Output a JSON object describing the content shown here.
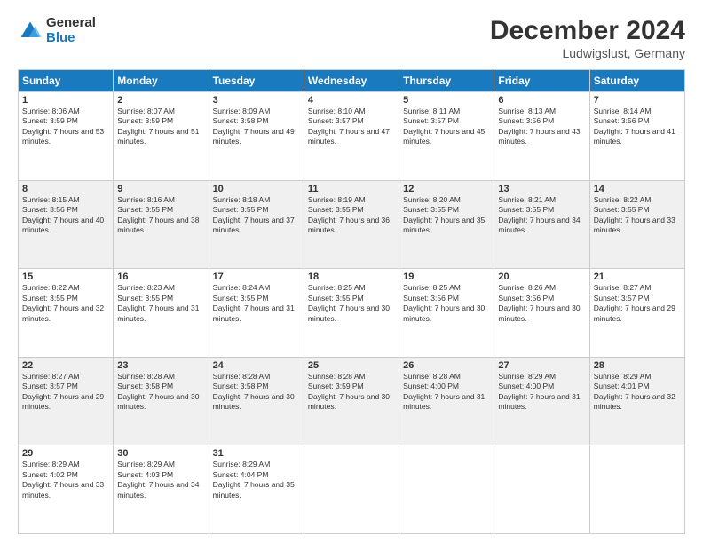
{
  "logo": {
    "general": "General",
    "blue": "Blue"
  },
  "header": {
    "month": "December 2024",
    "location": "Ludwigslust, Germany"
  },
  "weekdays": [
    "Sunday",
    "Monday",
    "Tuesday",
    "Wednesday",
    "Thursday",
    "Friday",
    "Saturday"
  ],
  "weeks": [
    [
      {
        "day": "1",
        "sunrise": "8:06 AM",
        "sunset": "3:59 PM",
        "daylight": "7 hours and 53 minutes."
      },
      {
        "day": "2",
        "sunrise": "8:07 AM",
        "sunset": "3:59 PM",
        "daylight": "7 hours and 51 minutes."
      },
      {
        "day": "3",
        "sunrise": "8:09 AM",
        "sunset": "3:58 PM",
        "daylight": "7 hours and 49 minutes."
      },
      {
        "day": "4",
        "sunrise": "8:10 AM",
        "sunset": "3:57 PM",
        "daylight": "7 hours and 47 minutes."
      },
      {
        "day": "5",
        "sunrise": "8:11 AM",
        "sunset": "3:57 PM",
        "daylight": "7 hours and 45 minutes."
      },
      {
        "day": "6",
        "sunrise": "8:13 AM",
        "sunset": "3:56 PM",
        "daylight": "7 hours and 43 minutes."
      },
      {
        "day": "7",
        "sunrise": "8:14 AM",
        "sunset": "3:56 PM",
        "daylight": "7 hours and 41 minutes."
      }
    ],
    [
      {
        "day": "8",
        "sunrise": "8:15 AM",
        "sunset": "3:56 PM",
        "daylight": "7 hours and 40 minutes."
      },
      {
        "day": "9",
        "sunrise": "8:16 AM",
        "sunset": "3:55 PM",
        "daylight": "7 hours and 38 minutes."
      },
      {
        "day": "10",
        "sunrise": "8:18 AM",
        "sunset": "3:55 PM",
        "daylight": "7 hours and 37 minutes."
      },
      {
        "day": "11",
        "sunrise": "8:19 AM",
        "sunset": "3:55 PM",
        "daylight": "7 hours and 36 minutes."
      },
      {
        "day": "12",
        "sunrise": "8:20 AM",
        "sunset": "3:55 PM",
        "daylight": "7 hours and 35 minutes."
      },
      {
        "day": "13",
        "sunrise": "8:21 AM",
        "sunset": "3:55 PM",
        "daylight": "7 hours and 34 minutes."
      },
      {
        "day": "14",
        "sunrise": "8:22 AM",
        "sunset": "3:55 PM",
        "daylight": "7 hours and 33 minutes."
      }
    ],
    [
      {
        "day": "15",
        "sunrise": "8:22 AM",
        "sunset": "3:55 PM",
        "daylight": "7 hours and 32 minutes."
      },
      {
        "day": "16",
        "sunrise": "8:23 AM",
        "sunset": "3:55 PM",
        "daylight": "7 hours and 31 minutes."
      },
      {
        "day": "17",
        "sunrise": "8:24 AM",
        "sunset": "3:55 PM",
        "daylight": "7 hours and 31 minutes."
      },
      {
        "day": "18",
        "sunrise": "8:25 AM",
        "sunset": "3:55 PM",
        "daylight": "7 hours and 30 minutes."
      },
      {
        "day": "19",
        "sunrise": "8:25 AM",
        "sunset": "3:56 PM",
        "daylight": "7 hours and 30 minutes."
      },
      {
        "day": "20",
        "sunrise": "8:26 AM",
        "sunset": "3:56 PM",
        "daylight": "7 hours and 30 minutes."
      },
      {
        "day": "21",
        "sunrise": "8:27 AM",
        "sunset": "3:57 PM",
        "daylight": "7 hours and 29 minutes."
      }
    ],
    [
      {
        "day": "22",
        "sunrise": "8:27 AM",
        "sunset": "3:57 PM",
        "daylight": "7 hours and 29 minutes."
      },
      {
        "day": "23",
        "sunrise": "8:28 AM",
        "sunset": "3:58 PM",
        "daylight": "7 hours and 30 minutes."
      },
      {
        "day": "24",
        "sunrise": "8:28 AM",
        "sunset": "3:58 PM",
        "daylight": "7 hours and 30 minutes."
      },
      {
        "day": "25",
        "sunrise": "8:28 AM",
        "sunset": "3:59 PM",
        "daylight": "7 hours and 30 minutes."
      },
      {
        "day": "26",
        "sunrise": "8:28 AM",
        "sunset": "4:00 PM",
        "daylight": "7 hours and 31 minutes."
      },
      {
        "day": "27",
        "sunrise": "8:29 AM",
        "sunset": "4:00 PM",
        "daylight": "7 hours and 31 minutes."
      },
      {
        "day": "28",
        "sunrise": "8:29 AM",
        "sunset": "4:01 PM",
        "daylight": "7 hours and 32 minutes."
      }
    ],
    [
      {
        "day": "29",
        "sunrise": "8:29 AM",
        "sunset": "4:02 PM",
        "daylight": "7 hours and 33 minutes."
      },
      {
        "day": "30",
        "sunrise": "8:29 AM",
        "sunset": "4:03 PM",
        "daylight": "7 hours and 34 minutes."
      },
      {
        "day": "31",
        "sunrise": "8:29 AM",
        "sunset": "4:04 PM",
        "daylight": "7 hours and 35 minutes."
      },
      null,
      null,
      null,
      null
    ]
  ]
}
